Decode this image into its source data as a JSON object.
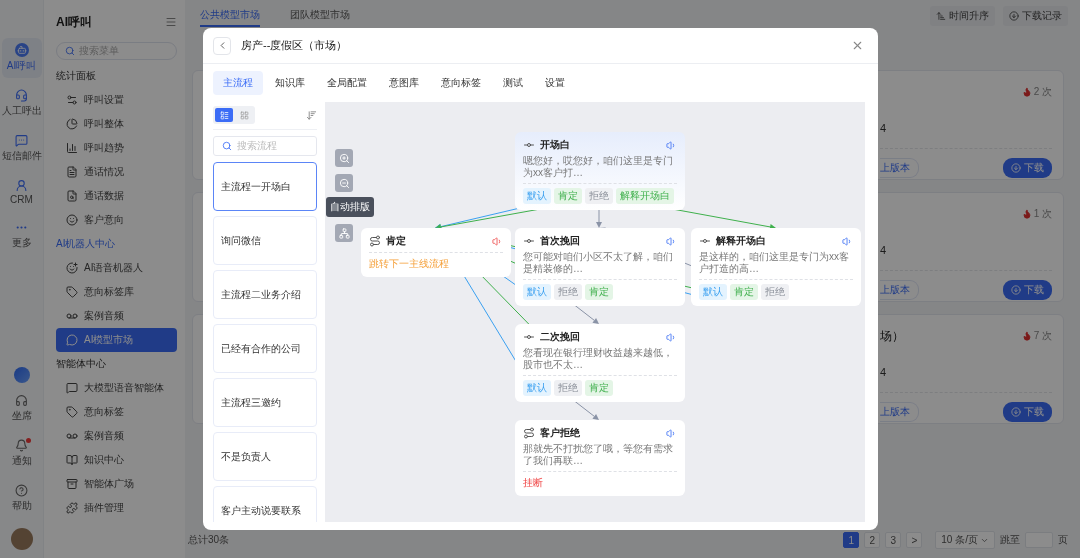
{
  "rail": {
    "items": [
      {
        "label": "AI呼叫",
        "selected": true
      },
      {
        "label": "人工呼出",
        "selected": false
      },
      {
        "label": "短信邮件",
        "selected": false
      },
      {
        "label": "CRM",
        "selected": false
      },
      {
        "label": "更多",
        "selected": false
      }
    ],
    "bottom": [
      {
        "label": "坐席",
        "badge": false
      },
      {
        "label": "通知",
        "badge": true
      },
      {
        "label": "帮助",
        "badge": false
      }
    ]
  },
  "sidebar": {
    "title": "AI呼叫",
    "search": {
      "placeholder": "搜索菜单"
    },
    "sections": [
      {
        "label": "统计面板",
        "active": false,
        "items": [
          {
            "label": "呼叫设置",
            "selected": false
          },
          {
            "label": "呼叫整体",
            "selected": false
          },
          {
            "label": "呼叫趋势",
            "selected": false
          },
          {
            "label": "通话情况",
            "selected": false
          },
          {
            "label": "通话数据",
            "selected": false
          },
          {
            "label": "客户意向",
            "selected": false
          }
        ]
      },
      {
        "label": "AI机器人中心",
        "active": true,
        "items": [
          {
            "label": "AI语音机器人",
            "selected": false
          },
          {
            "label": "意向标签库",
            "selected": false
          },
          {
            "label": "案例音频",
            "selected": false
          },
          {
            "label": "AI模型市场",
            "selected": true
          }
        ]
      },
      {
        "label": "智能体中心",
        "active": false,
        "items": [
          {
            "label": "大模型语音智能体",
            "selected": false
          },
          {
            "label": "意向标签",
            "selected": false
          },
          {
            "label": "案例音频",
            "selected": false
          },
          {
            "label": "知识中心",
            "selected": false
          },
          {
            "label": "智能体广场",
            "selected": false
          },
          {
            "label": "插件管理",
            "selected": false
          }
        ]
      }
    ]
  },
  "main": {
    "tabs": [
      {
        "label": "公共模型市场",
        "selected": true
      },
      {
        "label": "团队模型市场",
        "selected": false
      }
    ],
    "toolbar": [
      "时间升序",
      "下载记录"
    ],
    "cards": [
      {
        "hot": "2 次",
        "line": "4",
        "version": "上版本",
        "action": "下载"
      },
      {
        "hot": "1 次",
        "line": "4",
        "version": "上版本",
        "action": "下载"
      },
      {
        "title": "场）",
        "hot": "7 次",
        "line": "4",
        "version": "上版本",
        "action": "下载"
      }
    ],
    "footer": {
      "total": "总计30条",
      "pages": [
        {
          "label": "1",
          "selected": true
        },
        {
          "label": "2",
          "selected": false
        },
        {
          "label": "3",
          "selected": false
        }
      ],
      "next": ">",
      "page_size": "10 条/页",
      "jump": "跳至",
      "jump_suffix": "页"
    }
  },
  "modal": {
    "title": "房产--度假区（市场）",
    "tabs": [
      {
        "label": "主流程",
        "selected": true
      },
      {
        "label": "知识库",
        "selected": false
      },
      {
        "label": "全局配置",
        "selected": false
      },
      {
        "label": "意图库",
        "selected": false
      },
      {
        "label": "意向标签",
        "selected": false
      },
      {
        "label": "测试",
        "selected": false
      },
      {
        "label": "设置",
        "selected": false
      }
    ],
    "flows": {
      "view_modes": [
        {
          "kind": "list",
          "selected": true
        },
        {
          "kind": "grid",
          "selected": false
        }
      ],
      "search": {
        "placeholder": "搜索流程"
      },
      "items": [
        {
          "label": "主流程一开场白",
          "selected": true
        },
        {
          "label": "询问微信",
          "selected": false
        },
        {
          "label": "主流程二业务介绍",
          "selected": false
        },
        {
          "label": "已经有合作的公司",
          "selected": false
        },
        {
          "label": "主流程三邀约",
          "selected": false
        },
        {
          "label": "不是负责人",
          "selected": false
        },
        {
          "label": "客户主动说要联系",
          "selected": false
        }
      ]
    },
    "canvas": {
      "tooltip": "自动排版",
      "nodes": [
        {
          "kind": "start",
          "title": "开场白",
          "audio_alert": false,
          "text": "嗯您好，哎您好，咱们这里是专门为xx客户打…",
          "tags": [
            {
              "label": "默认",
              "kind": "default"
            },
            {
              "label": "肯定",
              "kind": "positive"
            },
            {
              "label": "拒绝",
              "kind": "negative"
            },
            {
              "label": "解释开场白",
              "kind": "positive"
            }
          ]
        },
        {
          "kind": "branch",
          "title": "肯定",
          "audio_alert": true,
          "action": {
            "label": "跳转下一主线流程",
            "kind": "jump"
          }
        },
        {
          "kind": "step",
          "title": "首次挽回",
          "audio_alert": false,
          "text": "您可能对咱们小区不太了解，咱们是精装修的…",
          "tags": [
            {
              "label": "默认",
              "kind": "default"
            },
            {
              "label": "拒绝",
              "kind": "negative"
            },
            {
              "label": "肯定",
              "kind": "positive"
            }
          ]
        },
        {
          "kind": "step",
          "title": "解释开场白",
          "audio_alert": false,
          "text": "是这样的，咱们这里是专门为xx客户打造的高…",
          "tags": [
            {
              "label": "默认",
              "kind": "default"
            },
            {
              "label": "肯定",
              "kind": "positive"
            },
            {
              "label": "拒绝",
              "kind": "negative"
            }
          ]
        },
        {
          "kind": "step",
          "title": "二次挽回",
          "audio_alert": false,
          "text": "您看现在银行理财收益越来越低，股市也不太…",
          "tags": [
            {
              "label": "默认",
              "kind": "default"
            },
            {
              "label": "拒绝",
              "kind": "negative"
            },
            {
              "label": "肯定",
              "kind": "positive"
            }
          ]
        },
        {
          "kind": "branch",
          "title": "客户拒绝",
          "audio_alert": false,
          "text": "那就先不打扰您了哦，等您有需求了我们再联…",
          "action": {
            "label": "挂断",
            "kind": "hangup"
          }
        }
      ]
    }
  }
}
